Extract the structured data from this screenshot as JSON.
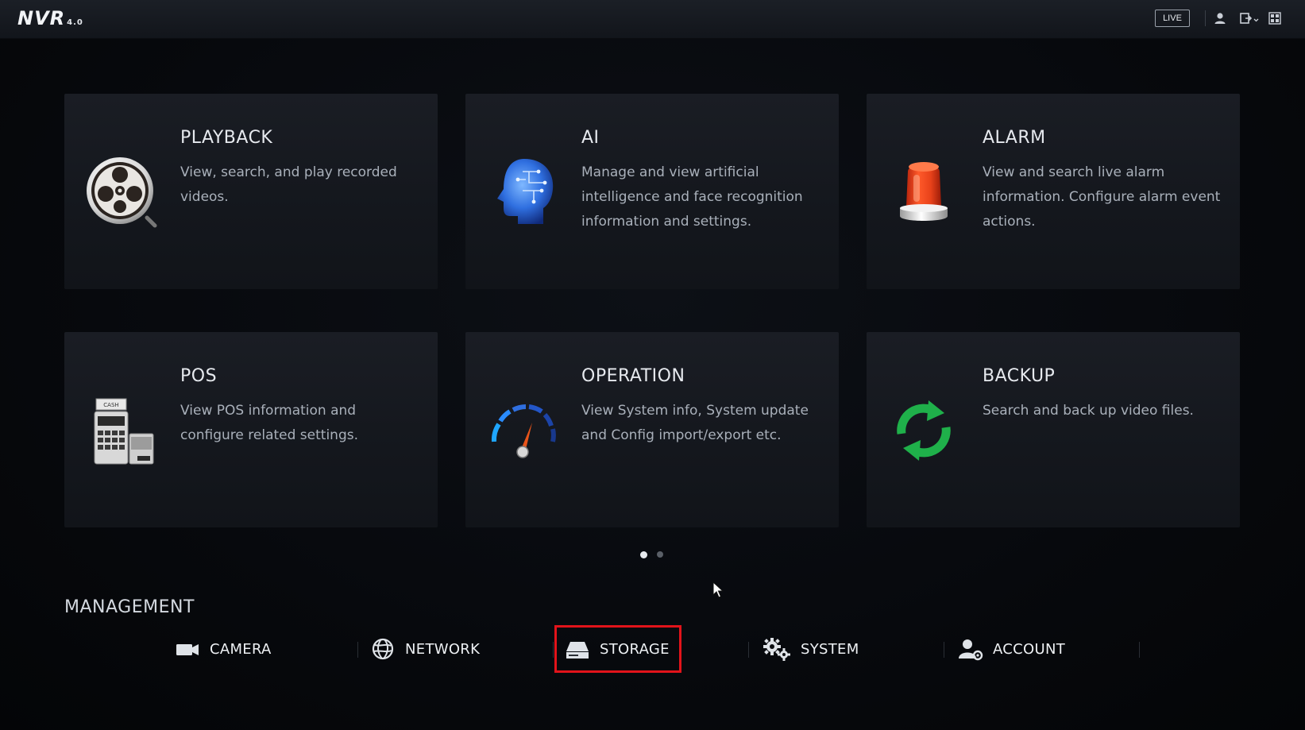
{
  "header": {
    "logo_text": "NVR",
    "logo_version": "4.0",
    "live_label": "LIVE",
    "icons": [
      "user-icon",
      "logout-icon",
      "layout-icon"
    ]
  },
  "cards": [
    {
      "title": "PLAYBACK",
      "description": "View, search, and play recorded videos.",
      "icon": "film-reel-icon"
    },
    {
      "title": "AI",
      "description": "Manage and view artificial intelligence and face recognition information and settings.",
      "icon": "ai-head-icon"
    },
    {
      "title": "ALARM",
      "description": "View and search live alarm information. Configure alarm event actions.",
      "icon": "alarm-light-icon"
    },
    {
      "title": "POS",
      "description": "View POS information and configure related settings.",
      "icon": "cash-register-icon"
    },
    {
      "title": "OPERATION",
      "description": "View System info, System update and Config import/export etc.",
      "icon": "gauge-icon"
    },
    {
      "title": "BACKUP",
      "description": "Search and back up video files.",
      "icon": "refresh-arrows-icon"
    }
  ],
  "pager": {
    "total": 2,
    "active": 1
  },
  "management": {
    "title": "MANAGEMENT",
    "items": [
      {
        "label": "CAMERA",
        "icon": "camera-icon"
      },
      {
        "label": "NETWORK",
        "icon": "network-globe-icon"
      },
      {
        "label": "STORAGE",
        "icon": "hard-drive-icon",
        "highlighted": true
      },
      {
        "label": "SYSTEM",
        "icon": "gears-icon"
      },
      {
        "label": "ACCOUNT",
        "icon": "user-settings-icon"
      }
    ]
  },
  "colors": {
    "highlight": "#e2131a",
    "alarm_red": "#e8421a",
    "backup_green": "#1fb04a",
    "ai_blue": "#2f6fe0"
  }
}
